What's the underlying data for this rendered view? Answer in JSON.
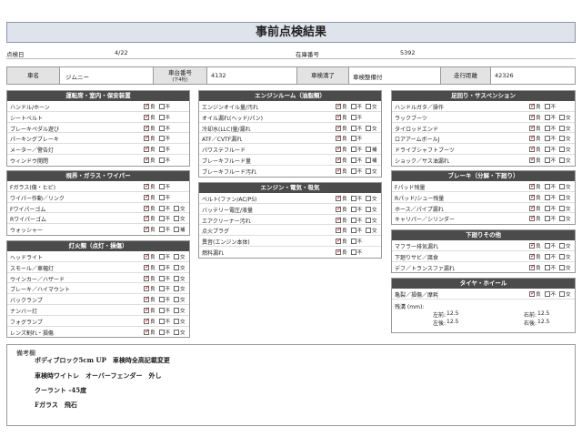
{
  "title": "事前点検結果",
  "header": {
    "inspection_date_label": "点検日",
    "inspection_date": "4/22",
    "stock_no_label": "在庫番号",
    "stock_no": "5392"
  },
  "car": {
    "name_label": "車名",
    "name": "ジムニー",
    "chassis_label": "車台番号",
    "chassis_sub": "(下4桁)",
    "chassis": "4132",
    "inspection_label": "車検満了",
    "inspection": "車検整備付",
    "mileage_label": "走行距離",
    "mileage": "42326"
  },
  "option_labels": {
    "good": "良",
    "bad": "不",
    "replace": "交",
    "refill": "補"
  },
  "sections": {
    "driver": {
      "title": "運転席・室内・保安装置",
      "items": [
        {
          "name": "ハンドル/ホーン",
          "opts": [
            "good",
            "bad"
          ]
        },
        {
          "name": "シートベルト",
          "opts": [
            "good",
            "bad"
          ]
        },
        {
          "name": "ブレーキペダル遊び",
          "opts": [
            "good",
            "bad"
          ]
        },
        {
          "name": "パーキングブレーキ",
          "opts": [
            "good",
            "bad"
          ]
        },
        {
          "name": "メーター／警告灯",
          "opts": [
            "good",
            "bad"
          ]
        },
        {
          "name": "ウィンドウ開閉",
          "opts": [
            "good",
            "bad"
          ]
        }
      ]
    },
    "visibility": {
      "title": "視界・ガラス・ワイパー",
      "items": [
        {
          "name": "Fガラス(傷・ヒビ)",
          "opts": [
            "good",
            "bad"
          ]
        },
        {
          "name": "ワイパー作動／リンク",
          "opts": [
            "good",
            "bad"
          ]
        },
        {
          "name": "Fワイパーゴム",
          "opts": [
            "good",
            "bad",
            "replace"
          ]
        },
        {
          "name": "Rワイパーゴム",
          "opts": [
            "good",
            "bad",
            "replace"
          ]
        },
        {
          "name": "ウォッシャー",
          "opts": [
            "good",
            "bad",
            "refill"
          ]
        }
      ]
    },
    "lights": {
      "title": "灯火類（点灯・損傷）",
      "items": [
        {
          "name": "ヘッドライト",
          "opts": [
            "good",
            "bad",
            "replace"
          ]
        },
        {
          "name": "スモール／車幅灯",
          "opts": [
            "good",
            "bad",
            "replace"
          ]
        },
        {
          "name": "ウインカー／ハザード",
          "opts": [
            "good",
            "bad",
            "replace"
          ]
        },
        {
          "name": "ブレーキ／ハイマウント",
          "opts": [
            "good",
            "bad",
            "replace"
          ]
        },
        {
          "name": "バックランプ",
          "opts": [
            "good",
            "bad",
            "replace"
          ]
        },
        {
          "name": "ナンバー灯",
          "opts": [
            "good",
            "bad",
            "replace"
          ]
        },
        {
          "name": "フォグランプ",
          "opts": [
            "good",
            "bad",
            "replace"
          ]
        },
        {
          "name": "レンズ割れ・損傷",
          "opts": [
            "good",
            "bad",
            "replace"
          ]
        }
      ]
    },
    "engine_room": {
      "title": "エンジンルーム（油脂類）",
      "items": [
        {
          "name": "エンジンオイル量/汚れ",
          "opts": [
            "good",
            "bad",
            "replace"
          ]
        },
        {
          "name": "オイル漏れ(ヘッド/パン)",
          "opts": [
            "good",
            "bad"
          ]
        },
        {
          "name": "冷却水(LLC)量/漏れ",
          "opts": [
            "good",
            "bad",
            "replace"
          ]
        },
        {
          "name": "ATF／CVTF漏れ",
          "opts": [
            "good",
            "bad"
          ]
        },
        {
          "name": "パワステフルード",
          "opts": [
            "good",
            "bad",
            "refill"
          ]
        },
        {
          "name": "ブレーキフルード量",
          "opts": [
            "good",
            "bad",
            "refill"
          ]
        },
        {
          "name": "ブレーキフルード汚れ",
          "opts": [
            "good",
            "bad",
            "replace"
          ]
        }
      ]
    },
    "engine_elec": {
      "title": "エンジン・電気・吸気",
      "items": [
        {
          "name": "ベルト(ファン/AC/PS)",
          "opts": [
            "good",
            "bad",
            "replace"
          ]
        },
        {
          "name": "バッテリー電圧/液量",
          "opts": [
            "good",
            "bad",
            "replace"
          ]
        },
        {
          "name": "エアクリーナー汚れ",
          "opts": [
            "good",
            "bad",
            "replace"
          ]
        },
        {
          "name": "点火プラグ",
          "opts": [
            "good",
            "bad",
            "replace"
          ]
        },
        {
          "name": "異音(エンジン本体)",
          "opts": [
            "good",
            "bad"
          ]
        },
        {
          "name": "燃料漏れ",
          "opts": [
            "good",
            "bad"
          ]
        }
      ]
    },
    "suspension": {
      "title": "足回り・サスペンション",
      "items": [
        {
          "name": "ハンドルガタ／操作",
          "opts": [
            "good",
            "bad"
          ]
        },
        {
          "name": "ラックブーツ",
          "opts": [
            "good",
            "bad",
            "replace"
          ]
        },
        {
          "name": "タイロッドエンド",
          "opts": [
            "good",
            "bad",
            "replace"
          ]
        },
        {
          "name": "ロアアームボールJ",
          "opts": [
            "good",
            "bad",
            "replace"
          ]
        },
        {
          "name": "ドライブシャフトブーツ",
          "opts": [
            "good",
            "bad",
            "replace"
          ]
        },
        {
          "name": "ショック／サス油漏れ",
          "opts": [
            "good",
            "bad",
            "replace"
          ]
        }
      ]
    },
    "brake": {
      "title": "ブレーキ（分解・下廻り）",
      "items": [
        {
          "name": "Fパッド残量",
          "opts": [
            "good",
            "bad",
            "replace"
          ]
        },
        {
          "name": "Rパッド/シュー残量",
          "opts": [
            "good",
            "bad",
            "replace"
          ]
        },
        {
          "name": "ホース／パイプ漏れ",
          "opts": [
            "good",
            "bad",
            "replace"
          ]
        },
        {
          "name": "キャリパー／シリンダー",
          "opts": [
            "good",
            "bad",
            "replace"
          ]
        }
      ]
    },
    "underbody": {
      "title": "下廻りその他",
      "items": [
        {
          "name": "マフラー排気漏れ",
          "opts": [
            "good",
            "bad",
            "replace"
          ]
        },
        {
          "name": "下廻りサビ／腐食",
          "opts": [
            "good",
            "bad",
            "replace"
          ]
        },
        {
          "name": "デフ／トランスファ漏れ",
          "opts": [
            "good",
            "bad",
            "replace"
          ]
        }
      ]
    },
    "tires": {
      "title": "タイヤ・ホイール",
      "items": [
        {
          "name": "亀裂／損傷／摩耗",
          "opts": [
            "good",
            "bad",
            "replace"
          ]
        }
      ],
      "tread_label": "残溝 (mm):",
      "fl_label": "左前:",
      "fl": "12.5",
      "fr_label": "右前:",
      "fr": "12.5",
      "rl_label": "左後:",
      "rl": "12.5",
      "rr_label": "右後:",
      "rr": "12.5"
    }
  },
  "remarks": {
    "label": "備考欄",
    "lines": [
      "ボディブロック5cm UP　車検時全高記載変更",
      "車検時ワイトレ　オーバーフェンダー　外し",
      "クーラント -45度",
      "Fガラス　飛石"
    ]
  }
}
